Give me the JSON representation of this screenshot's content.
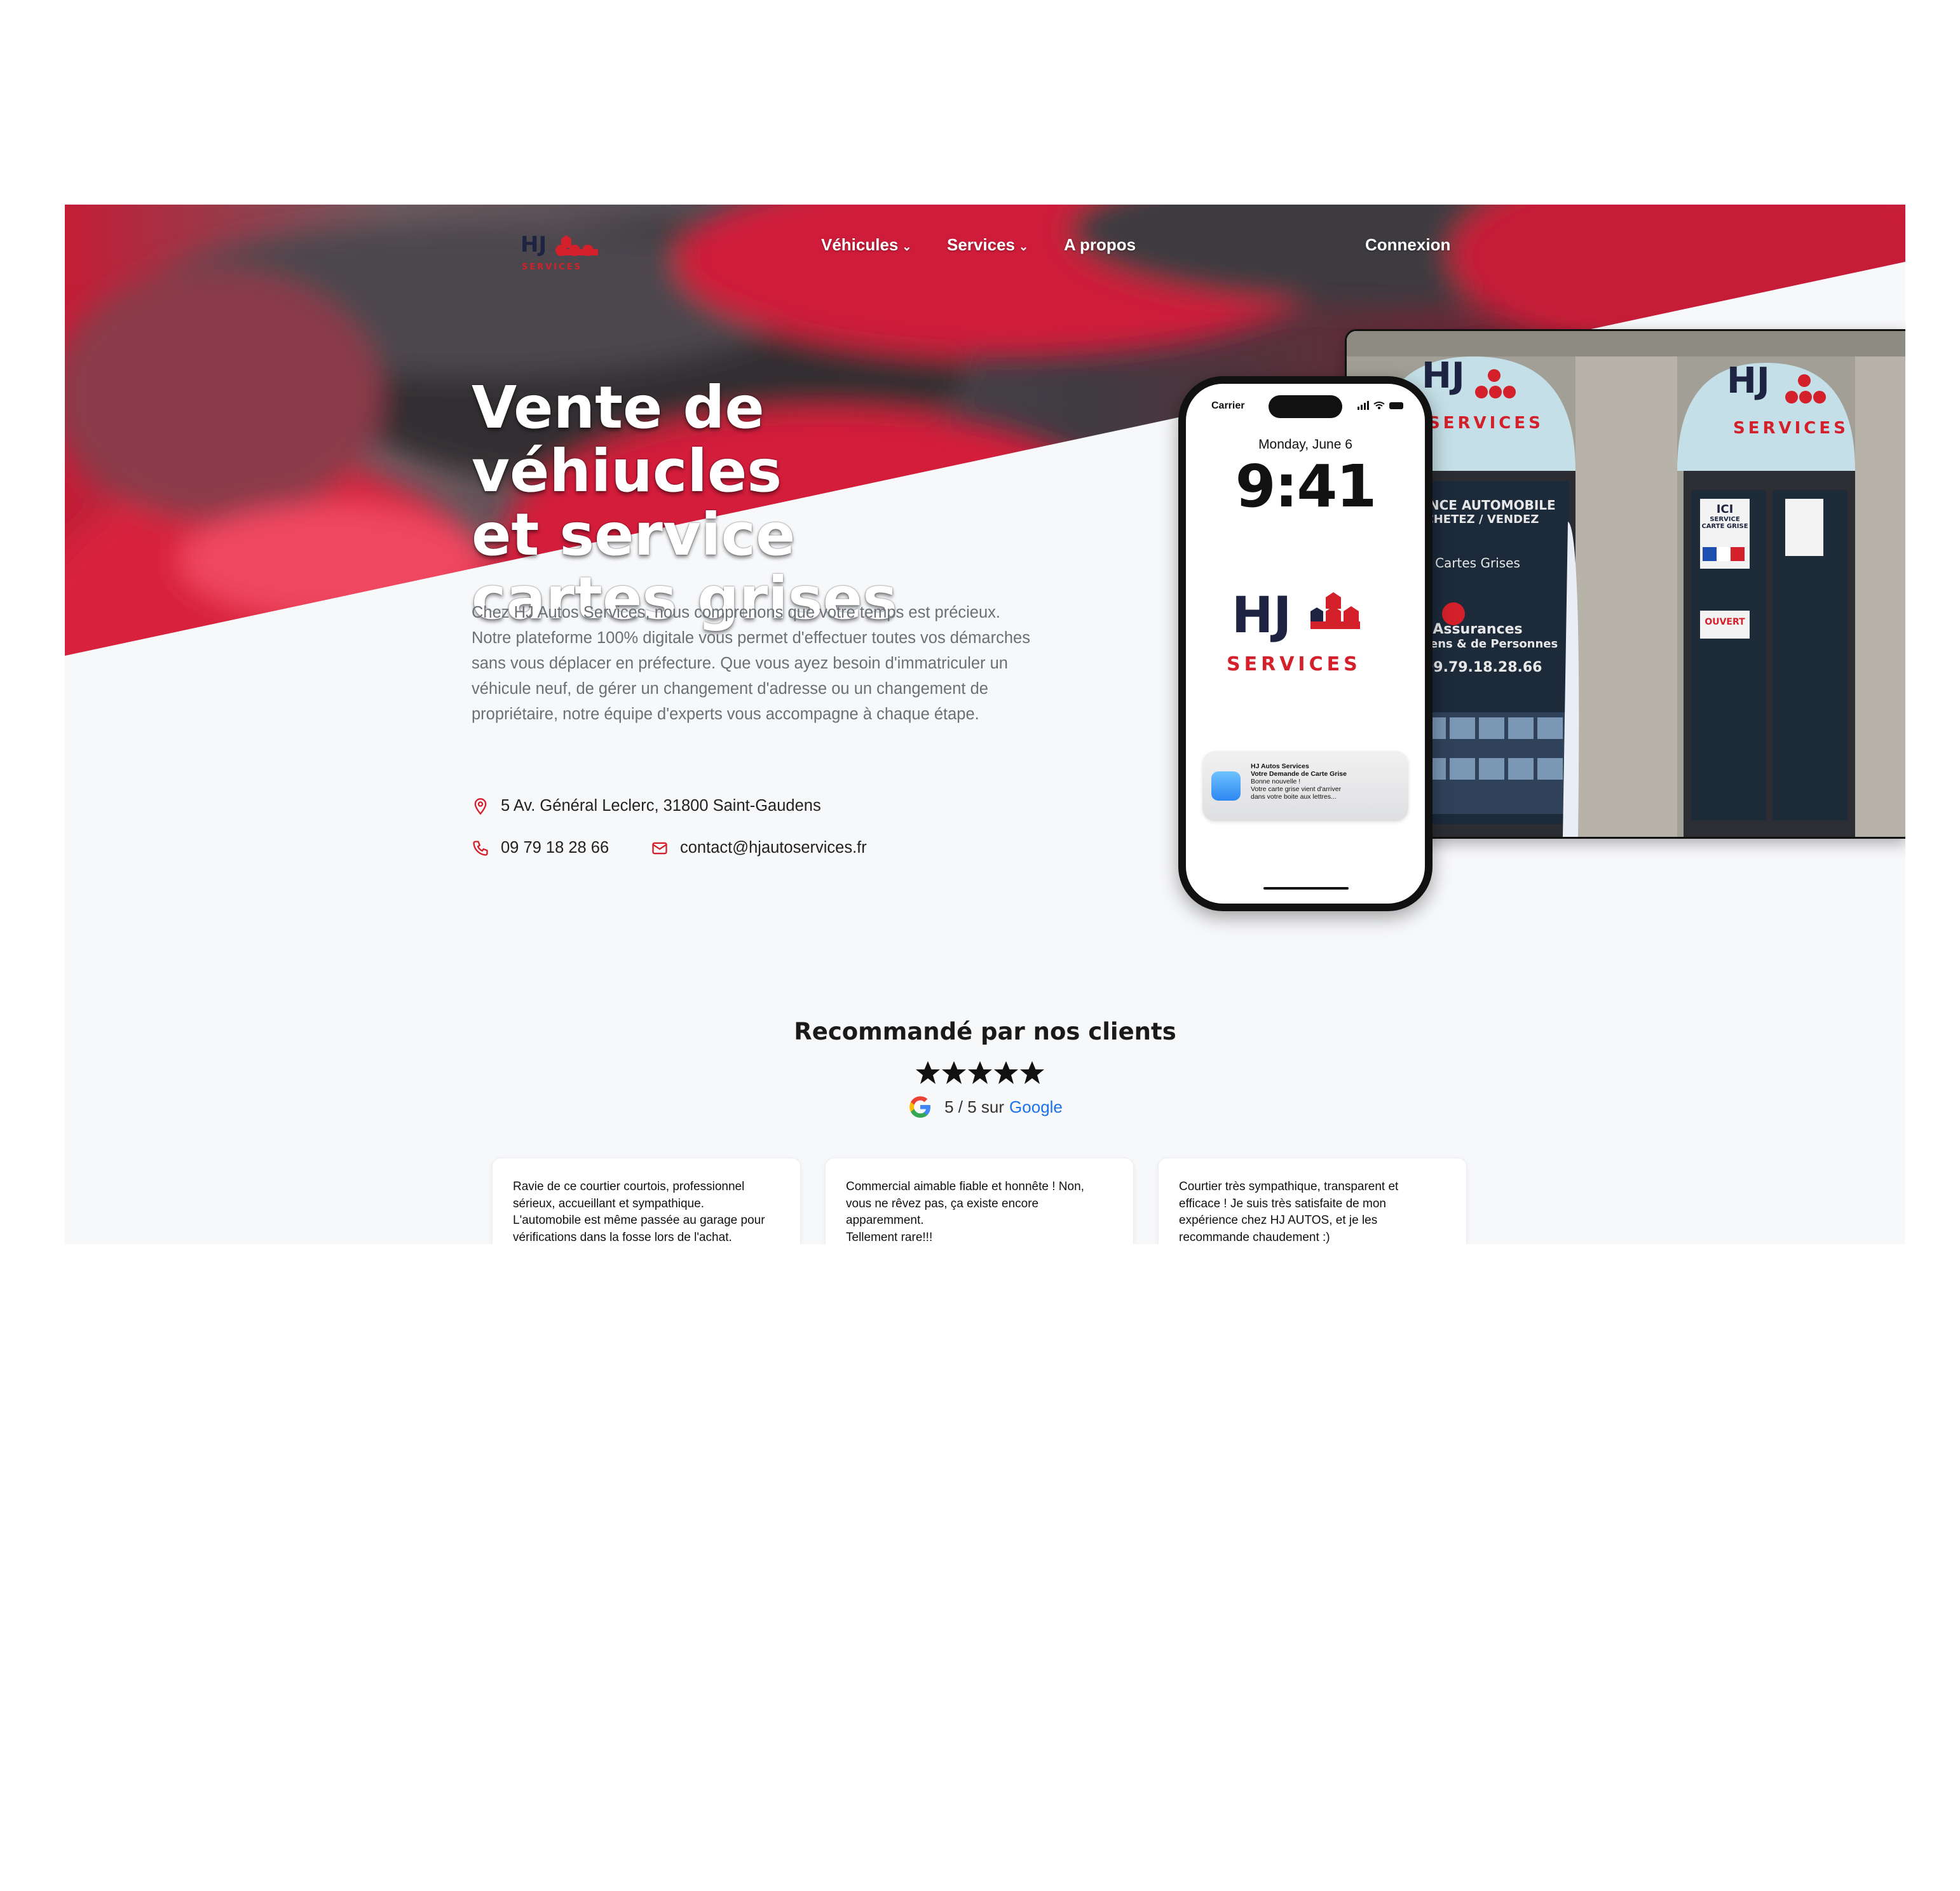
{
  "nav": {
    "logo_alt": "HJ SERVICES",
    "items": [
      {
        "label": "Véhicules",
        "has_dropdown": true
      },
      {
        "label": "Services",
        "has_dropdown": true
      },
      {
        "label": "A propos",
        "has_dropdown": false
      }
    ],
    "login": "Connexion"
  },
  "hero": {
    "title_lines": [
      "Vente de véhiucles",
      "et service",
      "cartes grises"
    ],
    "description": "Chez HJ Autos Services, nous comprenons que votre temps est précieux. Notre plateforme 100% digitale vous permet d'effectuer toutes vos démarches sans vous déplacer en préfecture. Que vous ayez besoin d'immatriculer un véhicule neuf, de gérer un changement d'adresse ou un changement de propriétaire, notre équipe d'experts vous accompagne à chaque étape.",
    "address": "5 Av. Général Leclerc, 31800 Saint-Gaudens",
    "phone": "09 79 18 28 66",
    "email": "contact@hjautoservices.fr",
    "icons": [
      "map-pin-icon",
      "phone-icon",
      "mail-icon"
    ]
  },
  "phone_mock": {
    "carrier": "Carrier",
    "date": "Monday, June 6",
    "time": "9:41",
    "brand_initials": "HJ",
    "brand_word": "SERVICES",
    "notification": {
      "app": "HJ Autos Services",
      "title": "Votre Demande de Carte Grise",
      "line1": "Bonne nouvelle !",
      "line2": "Votre carte grise vient d'arriver",
      "line3": "dans votre boite aux lettres..."
    }
  },
  "shop_photo": {
    "sign1": "HJ",
    "sign_services": "SERVICES",
    "window_l1": "AGENCE AUTOMOBILE",
    "window_l2": "ACHETEZ / VENDEZ",
    "window_l3": "Cartes Grises",
    "window_l4": "Assurances",
    "window_l5": "de Biens & de Personnes",
    "window_phone": ": 09.79.18.28.66",
    "door_l1": "ICI",
    "door_l2": "SERVICE",
    "door_l3": "CARTE GRISE",
    "door_open": "OUVERT"
  },
  "reviews": {
    "title": "Recommandé par nos clients",
    "stars": 5,
    "rating_text": "5 / 5 sur",
    "rating_source": "Google",
    "cards": [
      "Ravie de ce courtier courtois, professionnel\nsérieux, accueillant et sympathique.\nL'automobile est même passée au garage pour\nvérifications dans la fosse lors de l'achat.",
      "Commercial aimable fiable et honnête ! Non,\nvous ne rêvez pas, ça existe encore\napparemment.\nTellement rare!!!",
      "Courtier très sympathique, transparent et\nefficace ! Je suis très satisfaite de mon\nexpérience chez HJ AUTOS, et je les\nrecommande chaudement :)"
    ]
  },
  "colors": {
    "brand_red": "#d4202a",
    "brand_navy": "#1d2340",
    "page_bg": "#f7f8fa",
    "link_blue": "#1a73e8"
  }
}
